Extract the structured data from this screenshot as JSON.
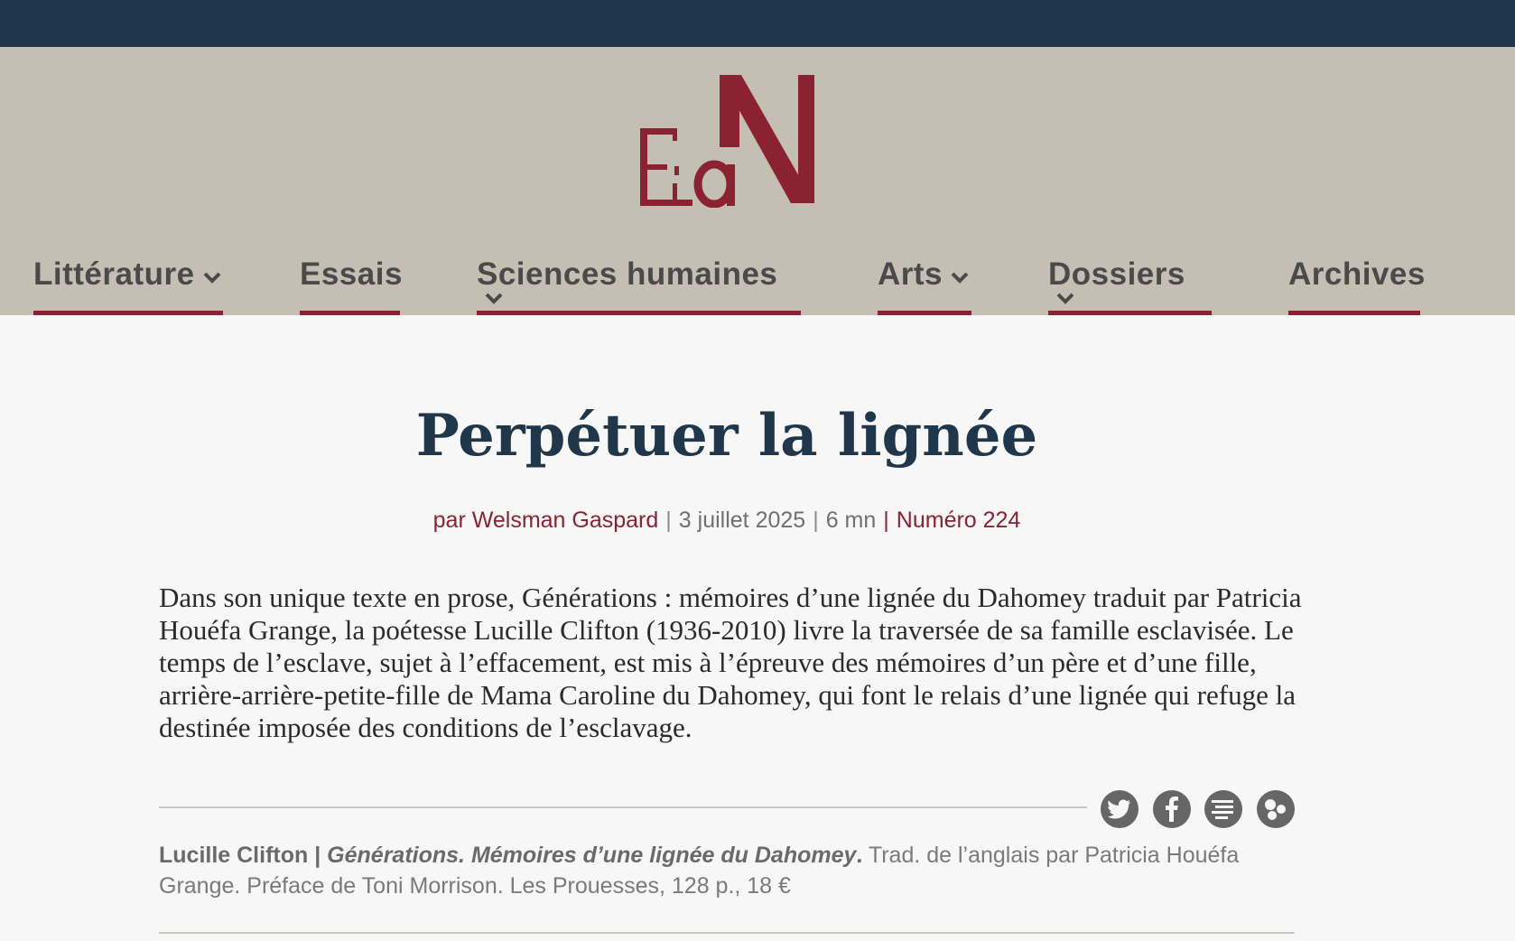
{
  "brand": {
    "logo_letters": "EaN",
    "colors": {
      "topbar": "#1f364b",
      "header": "#c5bfb3",
      "accent": "#8a2232",
      "title": "#1f364b"
    }
  },
  "nav": {
    "items": [
      {
        "label": "Littérature",
        "has_dropdown": true
      },
      {
        "label": "Essais",
        "has_dropdown": false
      },
      {
        "label": "Sciences humaines",
        "has_dropdown": true
      },
      {
        "label": "Arts",
        "has_dropdown": true
      },
      {
        "label": "Dossiers",
        "has_dropdown": true
      },
      {
        "label": "Archives",
        "has_dropdown": false
      }
    ]
  },
  "article": {
    "title": "Perpétuer la lignée",
    "author": "par Welsman Gaspard",
    "date": "3 juillet 2025",
    "reading_time": "6 mn",
    "issue": "Numéro 224",
    "lead": "Dans son unique texte en prose, Générations : mémoires d’une lignée du Dahomey traduit par Patricia Houéfa Grange, la poétesse Lucille Clifton (1936-2010) livre la traversée de sa famille esclavisée. Le temps de l’esclave, sujet à l’effacement, est mis à l’épreuve des mémoires d’un père et d’une fille, arrière-arrière-petite-fille de Mama Caroline du Dahomey, qui font le relais d’une lignée qui refuge la destinée imposée des conditions de l’esclavage."
  },
  "share": {
    "icons": [
      "twitter-icon",
      "facebook-icon",
      "print-icon",
      "share-icon"
    ]
  },
  "book": {
    "author": "Lucille Clifton |",
    "title": "Générations. Mémoires d’une lignée du Dahomey",
    "period": ".",
    "details": " Trad. de l’anglais par Patricia Houéfa Grange. Préface de Toni Morrison. Les Prouesses, 128 p., 18 €"
  }
}
